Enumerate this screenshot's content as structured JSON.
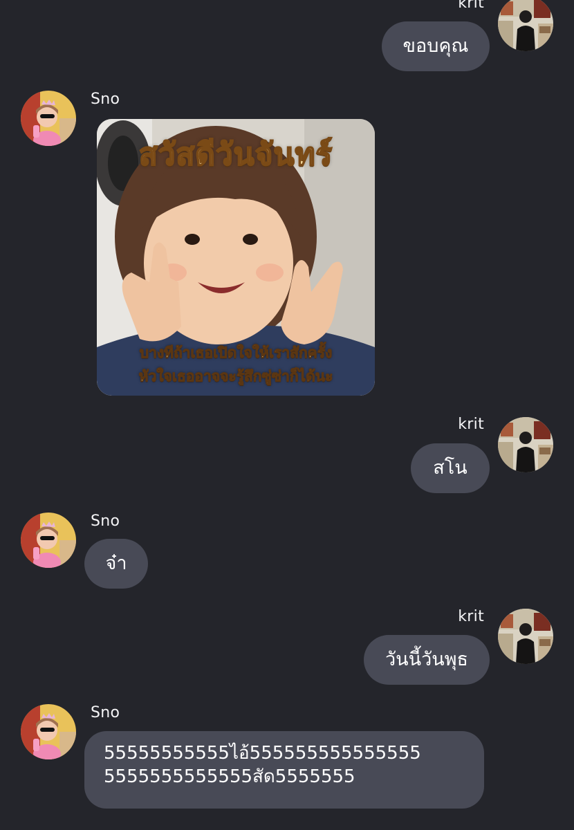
{
  "colors": {
    "background": "#24252b",
    "bubble": "#484a56",
    "text": "#ffffff",
    "name_text": "#f5f5f7"
  },
  "messages": [
    {
      "sender": "krit",
      "side": "right",
      "text": "ขอบคุณ",
      "avatar": "krit-avatar"
    },
    {
      "sender": "Sno",
      "side": "left",
      "type": "sticker",
      "avatar": "sno-avatar",
      "sticker": {
        "title": "สวัสดีวันจันทร์",
        "caption_line1": "บางทีถ้าเธอเปิดใจให้เราสักครั้ง",
        "caption_line2": "หัวใจเธออาจจะรู้สึกซู่ซ่าก็ได้นะ"
      }
    },
    {
      "sender": "krit",
      "side": "right",
      "text": "สโน",
      "avatar": "krit-avatar"
    },
    {
      "sender": "Sno",
      "side": "left",
      "text": "จ๋า",
      "avatar": "sno-avatar"
    },
    {
      "sender": "krit",
      "side": "right",
      "text": "วันนี้วันพุธ",
      "avatar": "krit-avatar"
    },
    {
      "sender": "Sno",
      "side": "left",
      "avatar": "sno-avatar",
      "lines": [
        "55555555555ไอ้555555555555555",
        "5555555555555สัด5555555"
      ]
    }
  ]
}
